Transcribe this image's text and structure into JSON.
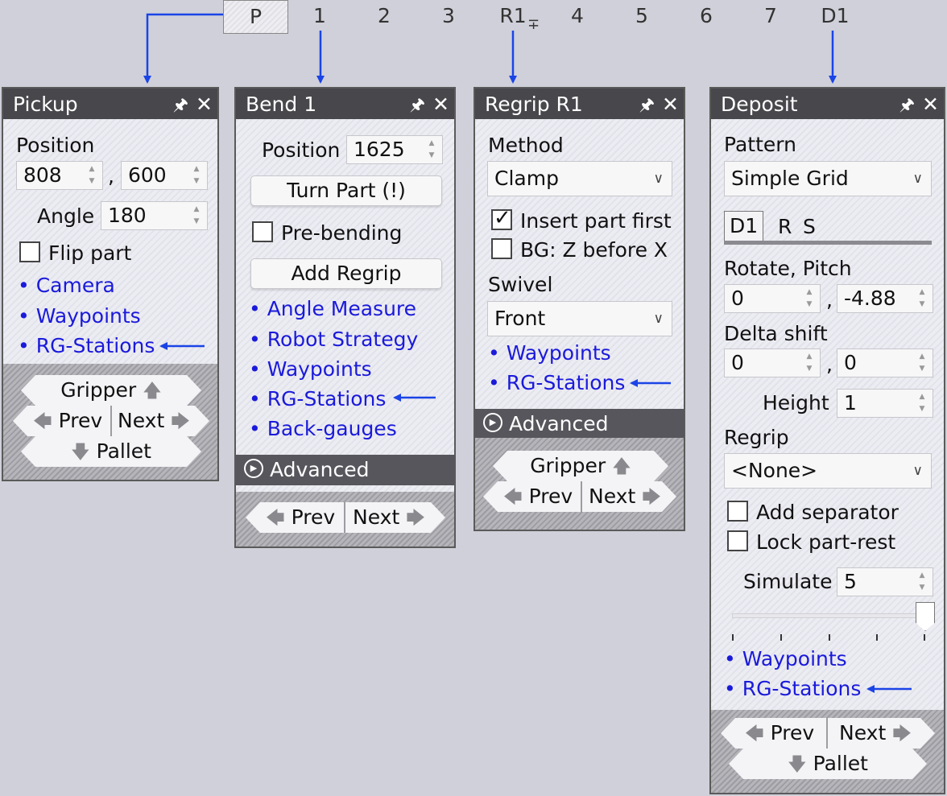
{
  "steps": {
    "p": "P",
    "s1": "1",
    "s2": "2",
    "s3": "3",
    "r1": "R1",
    "s4": "4",
    "s5": "5",
    "s6": "6",
    "s7": "7",
    "d1": "D1"
  },
  "icons": {
    "pin": "pin-icon",
    "close": "close-icon",
    "arrow_left": "arrow-left-icon",
    "arrow_right": "arrow-right-icon",
    "arrow_up": "arrow-up-icon",
    "arrow_down": "arrow-down-icon",
    "chevron": "chevron-down-icon",
    "play": "play-circle-icon",
    "check": "checkmark-icon"
  },
  "colors": {
    "link": "#1a1adb",
    "arrow": "#1a44e6",
    "title_bar": "#47474c",
    "advanced_bar": "#56565c"
  },
  "pickup": {
    "title": "Pickup",
    "position_label": "Position",
    "pos_x": "808",
    "pos_y": "600",
    "comma": ",",
    "angle_label": "Angle",
    "angle": "180",
    "flip_label": "Flip part",
    "links": [
      "• Camera",
      "• Waypoints",
      "• RG-Stations"
    ],
    "gripper": "Gripper",
    "prev": "Prev",
    "next": "Next",
    "pallet": "Pallet"
  },
  "bend": {
    "title": "Bend 1",
    "position_label": "Position",
    "position": "1625",
    "turn_part": "Turn Part (!)",
    "prebending_label": "Pre-bending",
    "add_regrip": "Add Regrip",
    "links": [
      "• Angle Measure",
      "• Robot Strategy",
      "• Waypoints",
      "• RG-Stations",
      "• Back-gauges"
    ],
    "advanced": "Advanced",
    "prev": "Prev",
    "next": "Next"
  },
  "regrip": {
    "title": "Regrip R1",
    "method_label": "Method",
    "method": "Clamp",
    "insert_label": "Insert part first",
    "bg_label": "BG: Z before X",
    "swivel_label": "Swivel",
    "swivel": "Front",
    "links": [
      "• Waypoints",
      "• RG-Stations"
    ],
    "advanced": "Advanced",
    "gripper": "Gripper",
    "prev": "Prev",
    "next": "Next"
  },
  "deposit": {
    "title": "Deposit",
    "pattern_label": "Pattern",
    "pattern": "Simple Grid",
    "tabs": [
      "D1",
      "R",
      "S"
    ],
    "rotate_label": "Rotate, Pitch",
    "rotate": "0",
    "pitch": "-4.88",
    "delta_label": "Delta shift",
    "delta_x": "0",
    "delta_y": "0",
    "comma": ",",
    "height_label": "Height",
    "height": "1",
    "regrip_label": "Regrip",
    "regrip": "<None>",
    "separator_label": "Add separator",
    "lock_label": "Lock part-rest",
    "simulate_label": "Simulate",
    "simulate": "5",
    "links": [
      "• Waypoints",
      "• RG-Stations"
    ],
    "prev": "Prev",
    "next": "Next",
    "pallet": "Pallet"
  }
}
